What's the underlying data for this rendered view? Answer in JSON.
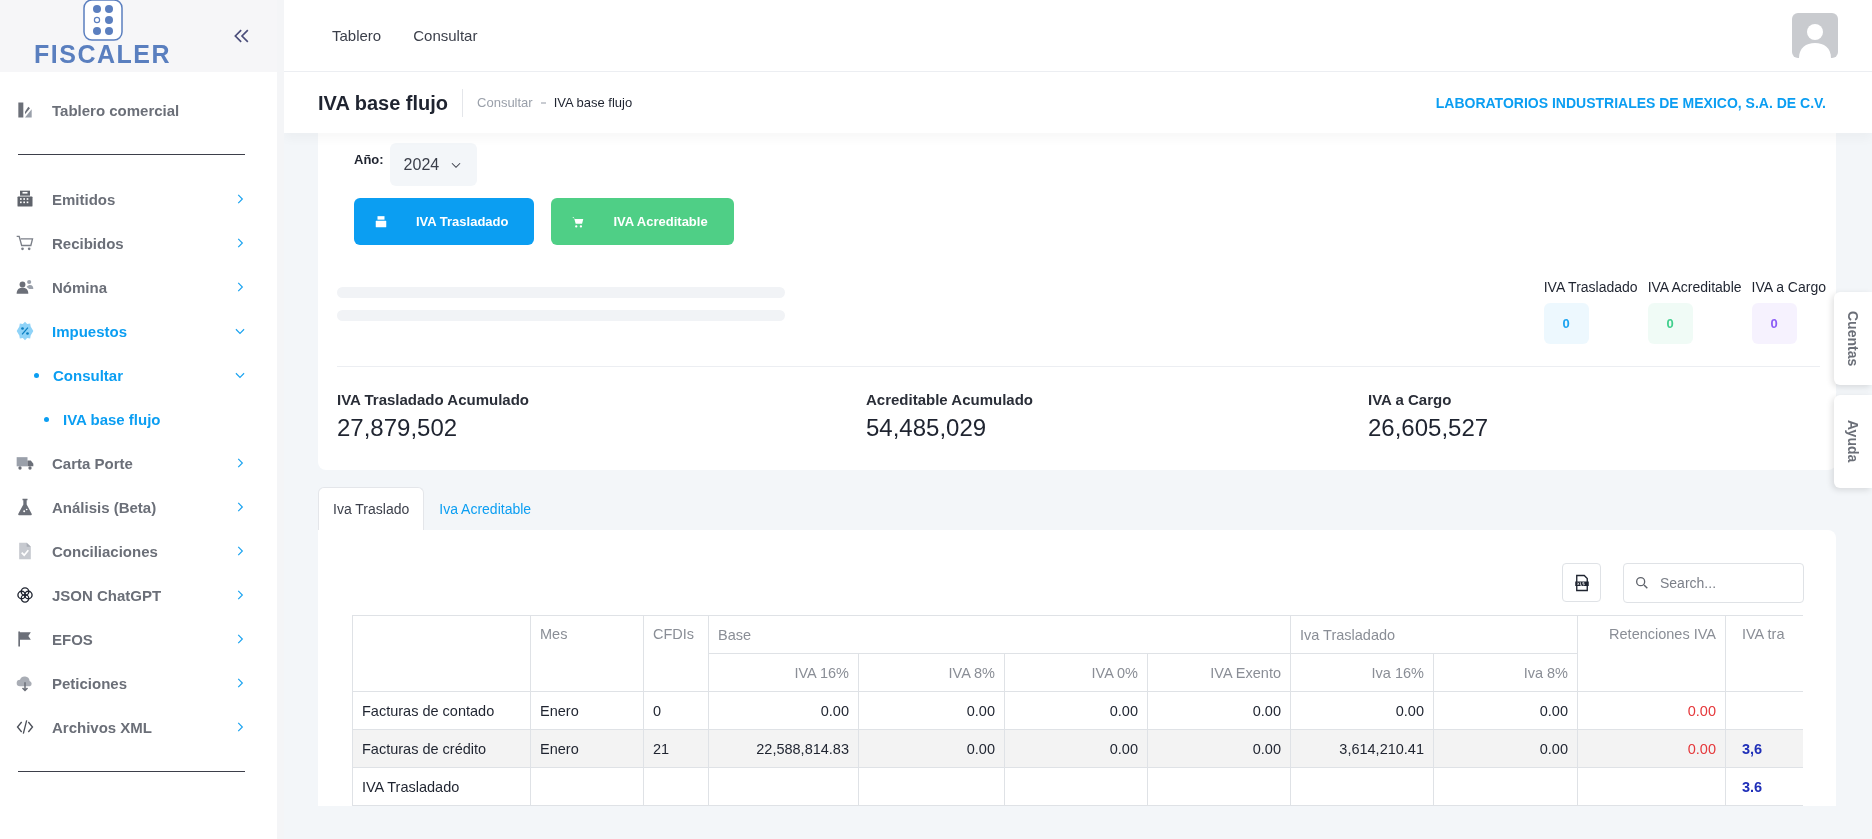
{
  "sidebar": {
    "logo_text": "FISCALER",
    "top_items": [
      {
        "label": "Tablero comercial",
        "selected": false
      }
    ],
    "items": [
      {
        "label": "Emitidos",
        "selected": false,
        "expanded": false
      },
      {
        "label": "Recibidos",
        "selected": false,
        "expanded": false
      },
      {
        "label": "Nómina",
        "selected": false,
        "expanded": false
      },
      {
        "label": "Impuestos",
        "selected": true,
        "expanded": true,
        "children": [
          {
            "label": "Consultar",
            "selected": true,
            "expanded": true,
            "children": [
              {
                "label": "IVA base flujo",
                "selected": true
              }
            ]
          }
        ]
      },
      {
        "label": "Carta Porte",
        "selected": false,
        "expanded": false
      },
      {
        "label": "Análisis (Beta)",
        "selected": false,
        "expanded": false
      },
      {
        "label": "Conciliaciones",
        "selected": false,
        "expanded": false
      },
      {
        "label": "JSON ChatGPT",
        "selected": false,
        "expanded": false
      },
      {
        "label": "EFOS",
        "selected": false,
        "expanded": false
      },
      {
        "label": "Peticiones",
        "selected": false,
        "expanded": false
      },
      {
        "label": "Archivos XML",
        "selected": false,
        "expanded": false
      }
    ]
  },
  "topbar": {
    "nav": [
      "Tablero",
      "Consultar"
    ]
  },
  "page_header": {
    "title": "IVA base flujo",
    "breadcrumb": [
      "Consultar",
      "IVA base flujo"
    ],
    "company": "LABORATORIOS INDUSTRIALES DE MEXICO, S.A. DE C.V."
  },
  "filters": {
    "year_label": "Año:",
    "year": "2024"
  },
  "actions": [
    {
      "label": "IVA Trasladado",
      "color": "#0b9ef2"
    },
    {
      "label": "IVA Acreditable",
      "color": "#4fcf86"
    }
  ],
  "summary_badges": [
    {
      "label": "IVA Trasladado",
      "value": "0",
      "color": "#1aa3f0"
    },
    {
      "label": "IVA Acreditable",
      "value": "0",
      "color": "#3fcf8c"
    },
    {
      "label": "IVA a Cargo",
      "value": "0",
      "color": "#8b5cf6"
    }
  ],
  "totals": [
    {
      "label": "IVA Trasladado Acumulado",
      "value": "27,879,502"
    },
    {
      "label": "Acreditable Acumulado",
      "value": "54,485,029"
    },
    {
      "label": "IVA a Cargo",
      "value": "26,605,527"
    }
  ],
  "tabs": [
    {
      "label": "Iva Traslado",
      "selected": true
    },
    {
      "label": "Iva Acreditable",
      "selected": false
    }
  ],
  "table": {
    "search": {
      "placeholder": "Search..."
    },
    "columns": [
      {
        "kind": "text"
      },
      {
        "label": "Mes",
        "kind": "text"
      },
      {
        "label": "CFDIs",
        "kind": "text"
      },
      {
        "label": "Base",
        "colspan": 4,
        "columns": [
          {
            "label": "IVA 16%",
            "kind": "amount"
          },
          {
            "label": "IVA 8%",
            "kind": "amount"
          },
          {
            "label": "IVA 0%",
            "kind": "amount"
          },
          {
            "label": "IVA Exento",
            "kind": "amount"
          }
        ]
      },
      {
        "label": "Iva Trasladado",
        "colspan": 2,
        "columns": [
          {
            "label": "Iva 16%",
            "kind": "amount"
          },
          {
            "label": "Iva 8%",
            "kind": "amount"
          }
        ]
      },
      {
        "label": "Retenciones IVA",
        "kind": "negative"
      },
      {
        "label": "IVA tra",
        "kind": "total"
      }
    ],
    "rows": [
      {
        "highlighted": false,
        "cells": [
          "Facturas de contado",
          "Enero",
          "0",
          "0.00",
          "0.00",
          "0.00",
          "0.00",
          "0.00",
          "0.00",
          "0.00",
          null
        ]
      },
      {
        "highlighted": true,
        "cells": [
          "Facturas de crédito",
          "Enero",
          "21",
          "22,588,814.83",
          "0.00",
          "0.00",
          "0.00",
          "3,614,210.41",
          "0.00",
          "0.00",
          "3,6"
        ]
      },
      {
        "highlighted": false,
        "cells": [
          "IVA Trasladado",
          null,
          null,
          null,
          null,
          null,
          null,
          null,
          null,
          null,
          "3.6"
        ]
      }
    ]
  },
  "side_tabs": [
    "Cuentas",
    "Ayuda"
  ]
}
